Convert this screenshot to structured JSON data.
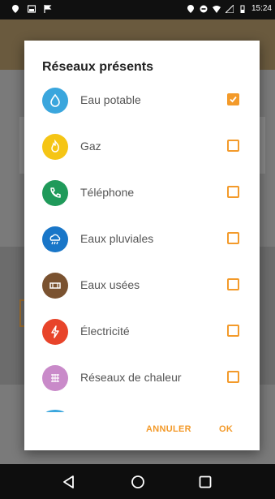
{
  "status_bar": {
    "time": "15:24",
    "left_icons": [
      "location-icon",
      "image-icon",
      "flag-icon"
    ],
    "right_icons": [
      "location-icon",
      "do-not-disturb-icon",
      "wifi-icon",
      "signal-icon",
      "battery-icon"
    ]
  },
  "dialog": {
    "title": "Réseaux présents",
    "items": [
      {
        "label": "Eau potable",
        "icon": "water-drop-icon",
        "color": "#3aa6dd",
        "checked": true
      },
      {
        "label": "Gaz",
        "icon": "flame-icon",
        "color": "#f5c515",
        "checked": false
      },
      {
        "label": "Téléphone",
        "icon": "phone-icon",
        "color": "#1f9a5a",
        "checked": false
      },
      {
        "label": "Eaux pluviales",
        "icon": "cloud-rain-icon",
        "color": "#1976c8",
        "checked": false
      },
      {
        "label": "Eaux usées",
        "icon": "pipe-icon",
        "color": "#7a5230",
        "checked": false
      },
      {
        "label": "Électricité",
        "icon": "lightning-icon",
        "color": "#e8442a",
        "checked": false
      },
      {
        "label": "Réseaux de chaleur",
        "icon": "heat-network-icon",
        "color": "#c98ac9",
        "checked": false
      }
    ],
    "partial_item_color": "#3aa6dd",
    "cancel_label": "ANNULER",
    "ok_label": "OK"
  },
  "colors": {
    "accent": "#f39a2a"
  }
}
